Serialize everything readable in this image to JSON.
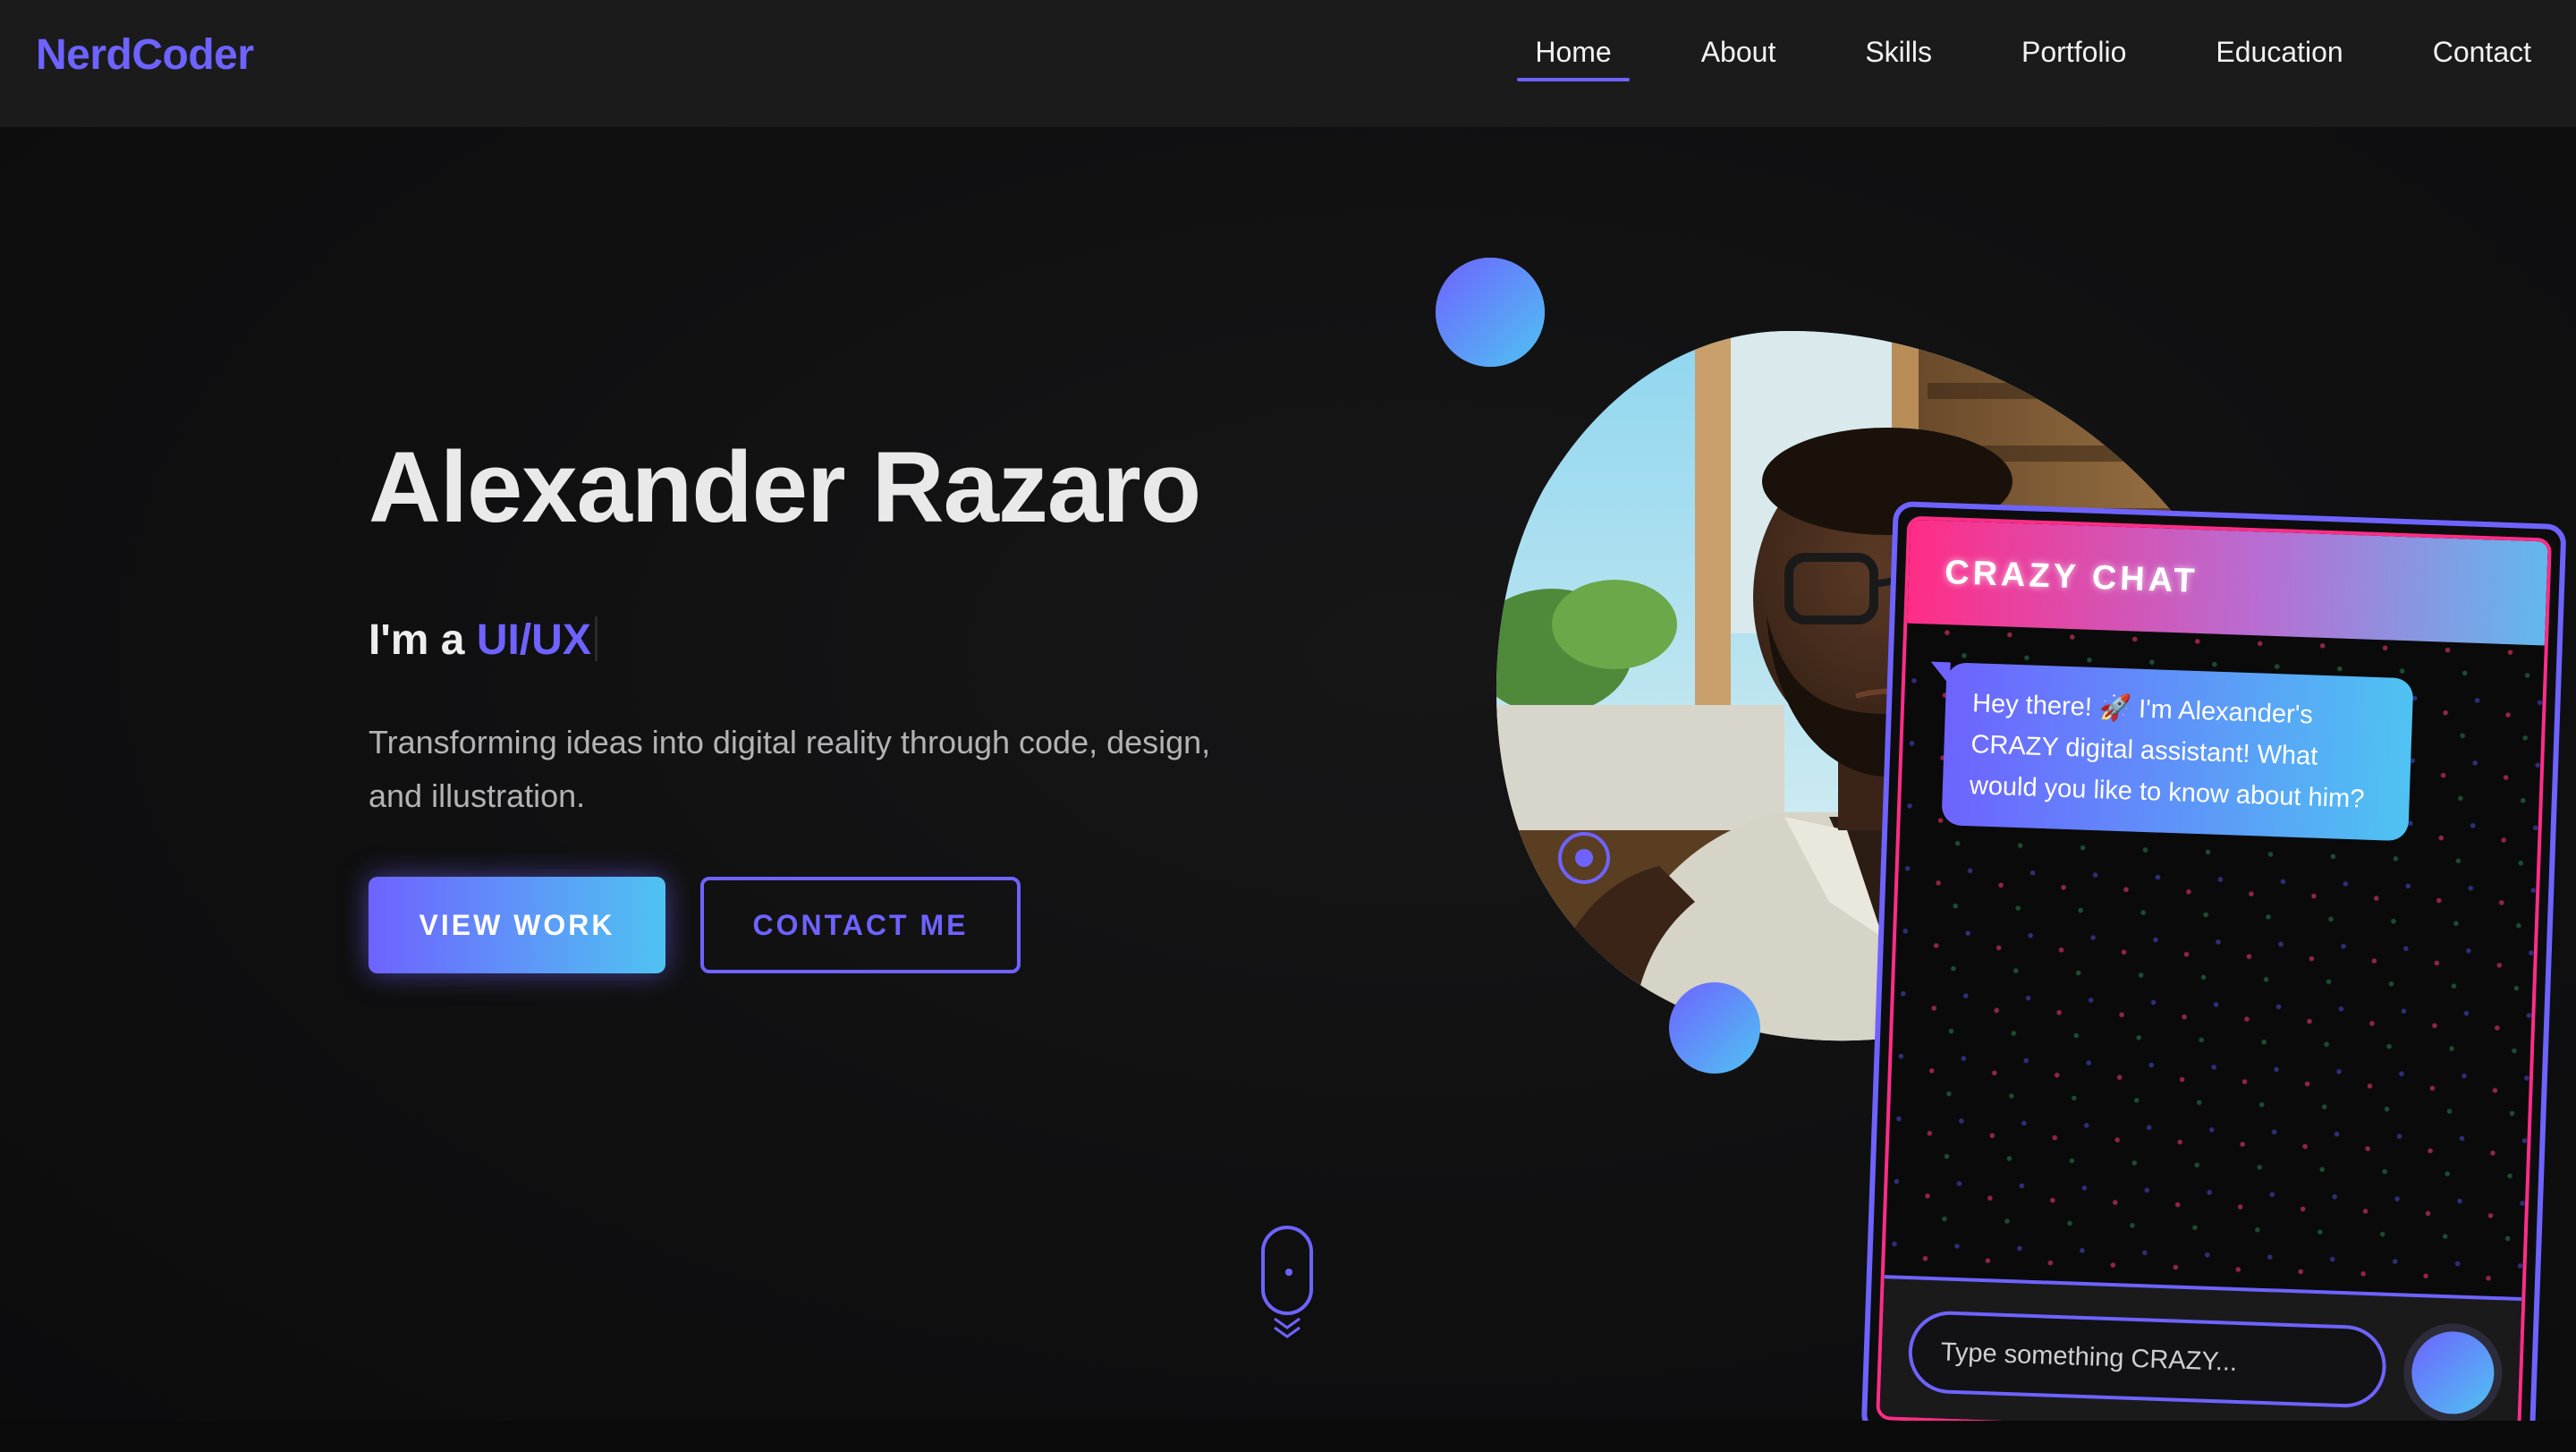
{
  "nav": {
    "logo": "NerdCoder",
    "links": [
      {
        "label": "Home",
        "active": true
      },
      {
        "label": "About",
        "active": false
      },
      {
        "label": "Skills",
        "active": false
      },
      {
        "label": "Portfolio",
        "active": false
      },
      {
        "label": "Education",
        "active": false
      },
      {
        "label": "Contact",
        "active": false
      }
    ]
  },
  "hero": {
    "name": "Alexander Razaro",
    "role_prefix": "I'm a",
    "role_highlight": "UI/UX",
    "tagline": "Transforming ideas into digital reality through code, design, and illustration.",
    "primary_button": "VIEW WORK",
    "secondary_button": "CONTACT ME"
  },
  "chat": {
    "title": "CRAZY CHAT",
    "greeting": "Hey there! 🚀 I'm Alexander's CRAZY digital assistant! What would you like to know about him?",
    "input_placeholder": "Type something CRAZY..."
  },
  "colors": {
    "accent": "#6e63ff",
    "accent_secondary": "#4fc3f2",
    "chat_pink": "#ff2d87",
    "background": "#0e0e0f",
    "nav_background": "#1b1b1c"
  },
  "icons": [
    "scroll-mouse-icon",
    "chevron-down-icon",
    "target-ring-icon",
    "send-icon"
  ]
}
